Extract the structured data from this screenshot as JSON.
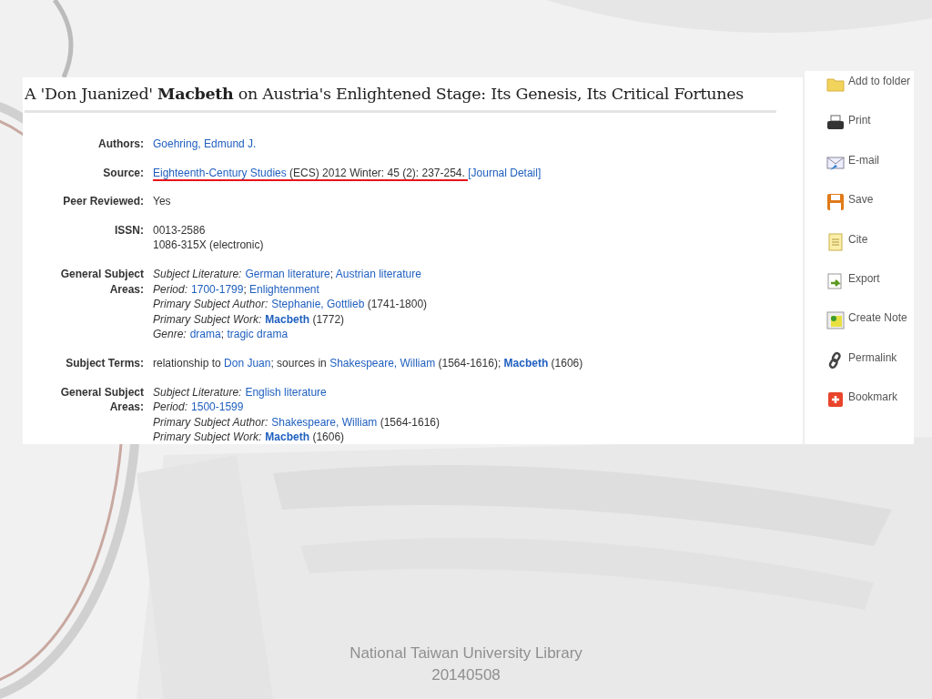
{
  "record": {
    "title": "A 'Don Juanized' **Macbeth** on Austria's Enlightened Stage: Its Genesis, Its Critical Fortunes",
    "fields": [
      {
        "label": "Authors:",
        "lines": [
          {
            "segments": [
              {
                "kind": "link",
                "text": "Goehring, Edmund J."
              }
            ]
          }
        ]
      },
      {
        "label": "Source:",
        "lines": [
          {
            "marked_segments": [
              {
                "kind": "link",
                "text": "Eighteenth-Century Studies"
              },
              {
                "kind": "plain",
                "text": " (ECS) 2012 Winter: 45 (2): 237-254. "
              }
            ],
            "segments": [
              {
                "kind": "link",
                "text": "[Journal Detail]"
              }
            ]
          }
        ]
      },
      {
        "label": "Peer Reviewed:",
        "lines": [
          {
            "segments": [
              {
                "kind": "plain",
                "text": "Yes"
              }
            ]
          }
        ]
      },
      {
        "label": "ISSN:",
        "lines": [
          {
            "segments": [
              {
                "kind": "plain",
                "text": "0013-2586"
              }
            ]
          },
          {
            "segments": [
              {
                "kind": "plain",
                "text": "1086-315X (electronic)"
              }
            ]
          }
        ]
      },
      {
        "label": "General Subject Areas:",
        "lines": [
          {
            "segments": [
              {
                "kind": "italic",
                "text": "Subject Literature:"
              },
              {
                "kind": "link",
                "text": "German literature"
              },
              {
                "kind": "plain",
                "text": "; "
              },
              {
                "kind": "link",
                "text": "Austrian literature"
              }
            ]
          },
          {
            "segments": [
              {
                "kind": "italic",
                "text": "Period:"
              },
              {
                "kind": "link",
                "text": "1700-1799"
              },
              {
                "kind": "plain",
                "text": "; "
              },
              {
                "kind": "link",
                "text": "Enlightenment"
              }
            ]
          },
          {
            "segments": [
              {
                "kind": "italic",
                "text": "Primary Subject Author:"
              },
              {
                "kind": "link",
                "text": "Stephanie, Gottlieb"
              },
              {
                "kind": "plain",
                "text": " (1741-1800)"
              }
            ]
          },
          {
            "segments": [
              {
                "kind": "italic",
                "text": "Primary Subject Work:"
              },
              {
                "kind": "boldlink",
                "text": "Macbeth"
              },
              {
                "kind": "plain",
                "text": " (1772)"
              }
            ]
          },
          {
            "segments": [
              {
                "kind": "italic",
                "text": "Genre:"
              },
              {
                "kind": "link",
                "text": "drama"
              },
              {
                "kind": "plain",
                "text": "; "
              },
              {
                "kind": "link",
                "text": "tragic drama"
              }
            ]
          }
        ]
      },
      {
        "label": "Subject Terms:",
        "lines": [
          {
            "segments": [
              {
                "kind": "plain",
                "text": "relationship to "
              },
              {
                "kind": "link",
                "text": "Don Juan"
              },
              {
                "kind": "plain",
                "text": "; sources in "
              },
              {
                "kind": "link",
                "text": "Shakespeare, William"
              },
              {
                "kind": "plain",
                "text": " (1564-1616); "
              },
              {
                "kind": "boldlink",
                "text": "Macbeth"
              },
              {
                "kind": "plain",
                "text": " (1606)"
              }
            ]
          }
        ]
      },
      {
        "label": "General Subject Areas:",
        "lines": [
          {
            "segments": [
              {
                "kind": "italic",
                "text": "Subject Literature:"
              },
              {
                "kind": "link",
                "text": "English literature"
              }
            ]
          },
          {
            "segments": [
              {
                "kind": "italic",
                "text": "Period:"
              },
              {
                "kind": "link",
                "text": "1500-1599"
              }
            ]
          },
          {
            "segments": [
              {
                "kind": "italic",
                "text": "Primary Subject Author:"
              },
              {
                "kind": "link",
                "text": "Shakespeare, William"
              },
              {
                "kind": "plain",
                "text": " (1564-1616)"
              }
            ]
          },
          {
            "segments": [
              {
                "kind": "italic",
                "text": "Primary Subject Work:"
              },
              {
                "kind": "boldlink",
                "text": "Macbeth"
              },
              {
                "kind": "plain",
                "text": " (1606)"
              }
            ]
          }
        ]
      }
    ]
  },
  "actions": [
    {
      "kind": "folder",
      "label": "Add to folder"
    },
    {
      "kind": "print",
      "label": "Print"
    },
    {
      "kind": "email",
      "label": "E-mail"
    },
    {
      "kind": "save",
      "label": "Save"
    },
    {
      "kind": "cite",
      "label": "Cite"
    },
    {
      "kind": "export",
      "label": "Export"
    },
    {
      "kind": "note",
      "label": "Create Note"
    },
    {
      "kind": "permalink",
      "label": "Permalink"
    },
    {
      "kind": "bookmark",
      "label": "Bookmark"
    }
  ],
  "footer": [
    "National Taiwan University Library",
    "20140508"
  ]
}
